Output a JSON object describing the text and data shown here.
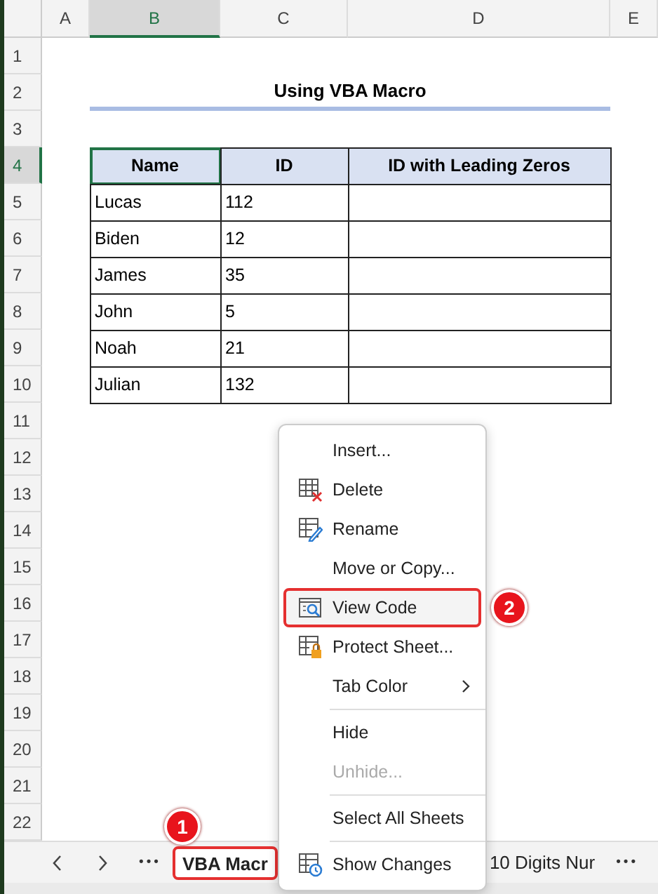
{
  "sheet": {
    "columns": [
      {
        "label": "A",
        "selected": false
      },
      {
        "label": "B",
        "selected": true
      },
      {
        "label": "C",
        "selected": false
      },
      {
        "label": "D",
        "selected": false
      },
      {
        "label": "E",
        "selected": false
      }
    ],
    "rows": [
      {
        "label": "1",
        "selected": false
      },
      {
        "label": "2",
        "selected": false
      },
      {
        "label": "3",
        "selected": false
      },
      {
        "label": "4",
        "selected": true
      },
      {
        "label": "5",
        "selected": false
      },
      {
        "label": "6",
        "selected": false
      },
      {
        "label": "7",
        "selected": false
      },
      {
        "label": "8",
        "selected": false
      },
      {
        "label": "9",
        "selected": false
      },
      {
        "label": "10",
        "selected": false
      },
      {
        "label": "11",
        "selected": false
      },
      {
        "label": "12",
        "selected": false
      },
      {
        "label": "13",
        "selected": false
      },
      {
        "label": "14",
        "selected": false
      },
      {
        "label": "15",
        "selected": false
      },
      {
        "label": "16",
        "selected": false
      },
      {
        "label": "17",
        "selected": false
      },
      {
        "label": "18",
        "selected": false
      },
      {
        "label": "19",
        "selected": false
      },
      {
        "label": "20",
        "selected": false
      },
      {
        "label": "21",
        "selected": false
      },
      {
        "label": "22",
        "selected": false
      }
    ]
  },
  "title": "Using VBA Macro",
  "table": {
    "columns": [
      {
        "label": "Name",
        "selected": true
      },
      {
        "label": "ID",
        "selected": false
      },
      {
        "label": "ID with Leading Zeros",
        "selected": false
      }
    ],
    "rows": [
      {
        "name": "Lucas",
        "id": "112"
      },
      {
        "name": "Biden",
        "id": "12"
      },
      {
        "name": "James",
        "id": "35"
      },
      {
        "name": "John",
        "id": "5"
      },
      {
        "name": "Noah",
        "id": "21"
      },
      {
        "name": "Julian",
        "id": "132"
      }
    ]
  },
  "context_menu": {
    "items": [
      {
        "kind": "item",
        "label": "Insert...",
        "disabled": false,
        "highlighted": false
      },
      {
        "kind": "item",
        "label": "Delete",
        "disabled": false,
        "highlighted": false
      },
      {
        "kind": "item",
        "label": "Rename",
        "disabled": false,
        "highlighted": false
      },
      {
        "kind": "item",
        "label": "Move or Copy...",
        "disabled": false,
        "highlighted": false
      },
      {
        "kind": "item",
        "label": "View Code",
        "disabled": false,
        "highlighted": true,
        "callout": "2"
      },
      {
        "kind": "item",
        "label": "Protect Sheet...",
        "disabled": false,
        "highlighted": false
      },
      {
        "kind": "submenu",
        "label": "Tab Color",
        "disabled": false,
        "highlighted": false
      },
      {
        "kind": "separator"
      },
      {
        "kind": "item",
        "label": "Hide",
        "disabled": false,
        "highlighted": false
      },
      {
        "kind": "item",
        "label": "Unhide...",
        "disabled": true,
        "highlighted": false
      },
      {
        "kind": "separator"
      },
      {
        "kind": "item",
        "label": "Select All Sheets",
        "disabled": false,
        "highlighted": false
      },
      {
        "kind": "separator"
      },
      {
        "kind": "item",
        "label": "Show Changes",
        "disabled": false,
        "highlighted": false
      }
    ]
  },
  "sheet_tabs": {
    "more_left": "•••",
    "tabs": [
      {
        "label": "VBA Macr",
        "selected": true,
        "callout": "1"
      },
      {
        "label": "10 Digits Nur",
        "selected": false
      }
    ],
    "more_right": "•••"
  }
}
